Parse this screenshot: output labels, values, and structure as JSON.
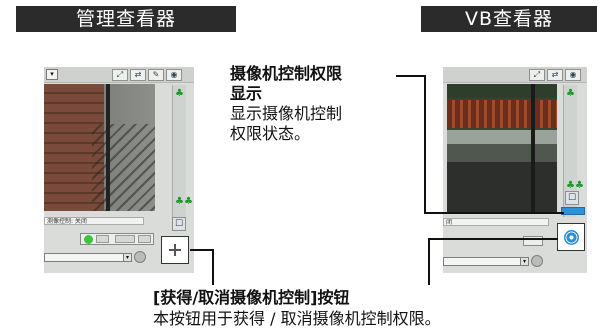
{
  "headers": {
    "left": "管理查看器",
    "right": "VB查看器"
  },
  "callout_status": {
    "title_line1": "摄像机控制权限",
    "title_line2": "显示",
    "body_line1": "显示摄像机控制",
    "body_line2": "权限状态。"
  },
  "callout_button": {
    "title": "[获得/取消摄像机控制]按钮",
    "body": "本按钮用于获得 / 取消摄像机控制权限。"
  },
  "left_viewer": {
    "status_text": "测像控制: 关闭"
  },
  "right_viewer": {
    "status_text": "闭"
  },
  "colors": {
    "header_bg": "#2b2b2b",
    "status_blue": "#2d92d8",
    "zoom_icon_green": "#1e9a2a"
  },
  "icons": {
    "crosshair": "crosshair-icon",
    "target": "camera-target-icon"
  }
}
